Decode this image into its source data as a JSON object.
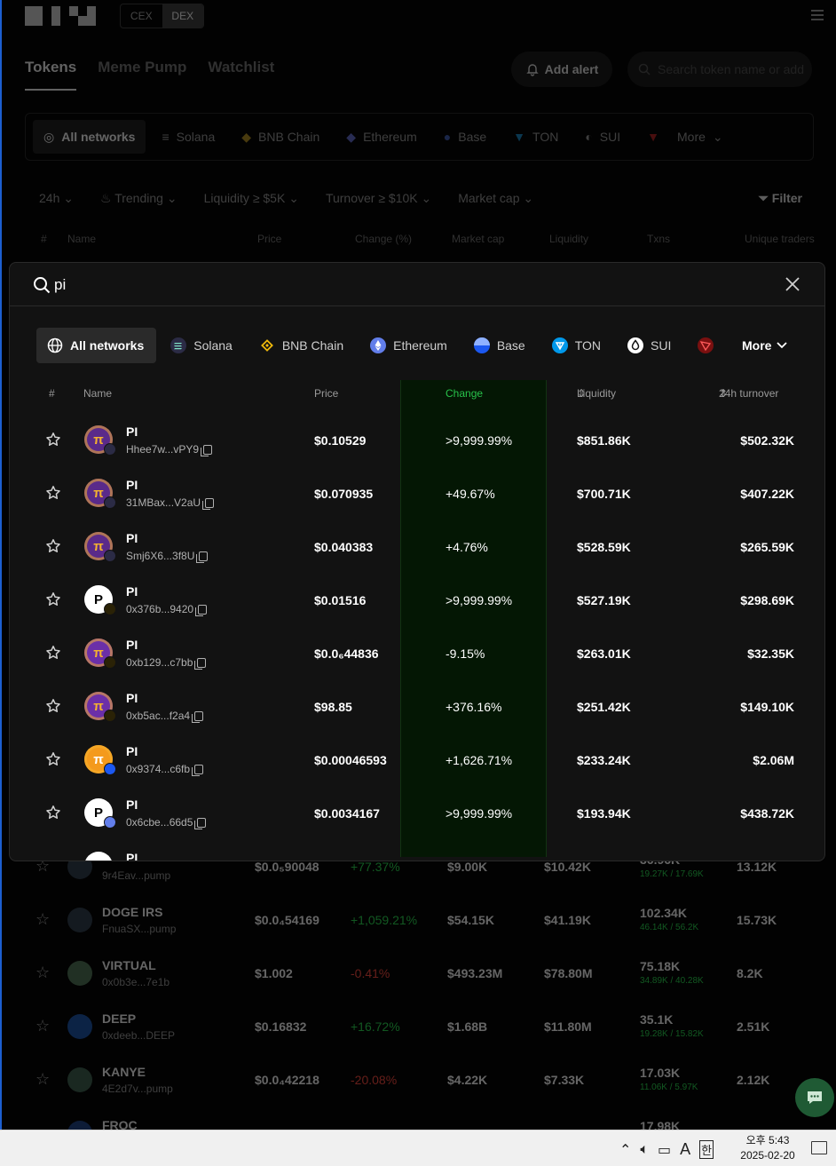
{
  "header": {
    "mode_cex": "CEX",
    "mode_dex": "DEX",
    "tabs": [
      "Tokens",
      "Meme Pump",
      "Watchlist"
    ],
    "add_alert": "Add alert",
    "search_placeholder": "Search token name or add"
  },
  "networks": [
    "All networks",
    "Solana",
    "BNB Chain",
    "Ethereum",
    "Base",
    "TON",
    "SUI"
  ],
  "networks_more": "More",
  "filters": {
    "period": "24h",
    "trending": "Trending",
    "liquidity": "Liquidity ≥ $5K",
    "turnover": "Turnover ≥ $10K",
    "market_cap": "Market cap",
    "filter_btn": "Filter"
  },
  "bg_table_headers": [
    "#",
    "Name",
    "Price",
    "Change (%)",
    "Market cap",
    "Liquidity",
    "Txns",
    "Unique traders"
  ],
  "bg_rows": [
    {
      "name": "",
      "addr": "9r4Eav...pump",
      "price": "$0.0₅90048",
      "change": "+77.37%",
      "mcap": "$9.00K",
      "liq": "$10.42K",
      "txns": "36.96K",
      "txns_split": "19.27K / 17.69K",
      "traders": "13.12K"
    },
    {
      "name": "DOGE IRS",
      "addr": "FnuaSX...pump",
      "price": "$0.0₄54169",
      "change": "+1,059.21%",
      "mcap": "$54.15K",
      "liq": "$41.19K",
      "txns": "102.34K",
      "txns_split": "46.14K / 56.2K",
      "traders": "15.73K"
    },
    {
      "name": "VIRTUAL",
      "addr": "0x0b3e...7e1b",
      "price": "$1.002",
      "change": "-0.41%",
      "mcap": "$493.23M",
      "liq": "$78.80M",
      "txns": "75.18K",
      "txns_split": "34.89K / 40.28K",
      "traders": "8.2K"
    },
    {
      "name": "DEEP",
      "addr": "0xdeeb...DEEP",
      "price": "$0.16832",
      "change": "+16.72%",
      "mcap": "$1.68B",
      "liq": "$11.80M",
      "txns": "35.1K",
      "txns_split": "19.28K / 15.82K",
      "traders": "2.51K"
    },
    {
      "name": "KANYE",
      "addr": "4E2d7v...pump",
      "price": "$0.0₄42218",
      "change": "-20.08%",
      "mcap": "$4.22K",
      "liq": "$7.33K",
      "txns": "17.03K",
      "txns_split": "11.06K / 5.97K",
      "traders": "2.12K"
    },
    {
      "name": "FROC",
      "addr": "",
      "price": "",
      "change": "",
      "mcap": "",
      "liq": "",
      "txns": "17.98K",
      "txns_split": "",
      "traders": ""
    }
  ],
  "search": {
    "query": "pi",
    "networks": [
      "All networks",
      "Solana",
      "BNB Chain",
      "Ethereum",
      "Base",
      "TON",
      "SUI"
    ],
    "more": "More",
    "headers": {
      "num": "#",
      "name": "Name",
      "price": "Price",
      "change": "Change",
      "liquidity": "Liquidity",
      "turnover": "24h turnover"
    },
    "results": [
      {
        "symbol": "PI",
        "addr": "Hhee7w...vPY9",
        "price": "$0.10529",
        "change": ">9,999.99%",
        "liquidity": "$851.86K",
        "turnover": "$502.32K",
        "avatar": "pi-purple",
        "chain": "solana"
      },
      {
        "symbol": "PI",
        "addr": "31MBax...V2aU",
        "price": "$0.070935",
        "change": "+49.67%",
        "liquidity": "$700.71K",
        "turnover": "$407.22K",
        "avatar": "pi-purple",
        "chain": "solana"
      },
      {
        "symbol": "PI",
        "addr": "Smj6X6...3f8U",
        "price": "$0.040383",
        "change": "+4.76%",
        "liquidity": "$528.59K",
        "turnover": "$265.59K",
        "avatar": "pi-purple",
        "chain": "solana"
      },
      {
        "symbol": "PI",
        "addr": "0x376b...9420",
        "price": "$0.01516",
        "change": ">9,999.99%",
        "liquidity": "$527.19K",
        "turnover": "$298.69K",
        "avatar": "p-white",
        "chain": "bnb"
      },
      {
        "symbol": "PI",
        "addr": "0xb129...c7bb",
        "price": "$0.0₆44836",
        "change": "-9.15%",
        "liquidity": "$263.01K",
        "turnover": "$32.35K",
        "avatar": "pi-purple-gold",
        "chain": "bnb"
      },
      {
        "symbol": "PI",
        "addr": "0xb5ac...f2a4",
        "price": "$98.85",
        "change": "+376.16%",
        "liquidity": "$251.42K",
        "turnover": "$149.10K",
        "avatar": "pi-purple-gold",
        "chain": "bnb"
      },
      {
        "symbol": "PI",
        "addr": "0x9374...c6fb",
        "price": "$0.00046593",
        "change": "+1,626.71%",
        "liquidity": "$233.24K",
        "turnover": "$2.06M",
        "avatar": "pi-orange",
        "chain": "base"
      },
      {
        "symbol": "PI",
        "addr": "0x6cbe...66d5",
        "price": "$0.0034167",
        "change": ">9,999.99%",
        "liquidity": "$193.94K",
        "turnover": "$438.72K",
        "avatar": "p-white",
        "chain": "ethereum"
      },
      {
        "symbol": "PI",
        "addr": "",
        "price": "",
        "change": "",
        "liquidity": "",
        "turnover": "",
        "avatar": "p-white",
        "chain": ""
      }
    ]
  },
  "taskbar": {
    "ime": "A",
    "ime2": "한",
    "time": "오후 5:43",
    "date": "2025-02-20"
  },
  "colors": {
    "positive": "#2ec85a",
    "negative": "#e6592c",
    "change_column_bg": "#041704"
  }
}
